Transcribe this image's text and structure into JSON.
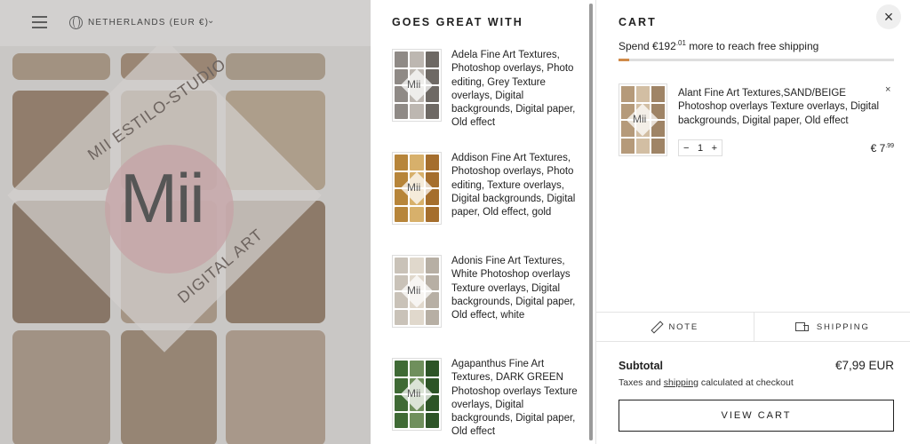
{
  "background": {
    "country_selector": "NETHERLANDS (EUR €)",
    "logo": {
      "wordmark": "Mii",
      "top_text": "MII ESTILO-STUDIO",
      "bottom_text": "DIGITAL ART"
    }
  },
  "upsell": {
    "title": "GOES GREAT WITH",
    "items": [
      {
        "title": "Adela Fine Art Textures, Photoshop overlays, Photo editing, Grey Texture overlays, Digital backgrounds, Digital paper, Old effect",
        "palette": [
          "#8f8a86",
          "#bdb7b1",
          "#6e6964",
          "#a7a19b"
        ]
      },
      {
        "title": "Addison Fine Art Textures, Photoshop overlays, Photo editing, Texture overlays, Digital backgrounds, Digital paper, Old effect, gold",
        "palette": [
          "#b7853a",
          "#d7b06b",
          "#a56e2d",
          "#e4c58a"
        ]
      },
      {
        "title": "Adonis Fine Art Textures, White Photoshop overlays Texture overlays, Digital backgrounds, Digital paper, Old effect, white",
        "palette": [
          "#c9c2b8",
          "#e0d8cc",
          "#b7afa4",
          "#ece6dc"
        ]
      },
      {
        "title": "Agapanthus Fine Art Textures, DARK GREEN Photoshop overlays Texture overlays, Digital backgrounds, Digital paper, Old effect",
        "palette": [
          "#3f6a35",
          "#6f8f5c",
          "#2d5427",
          "#8ba877"
        ]
      }
    ]
  },
  "cart": {
    "title": "CART",
    "shipping_message": {
      "prefix": "Spend",
      "currency": "€",
      "amount_main": "192",
      "amount_cents": ".01",
      "suffix": "more to reach free shipping"
    },
    "shipping_progress": 0.04,
    "line_item": {
      "title": "Alant Fine Art Textures,SAND/BEIGE Photoshop overlays Texture overlays, Digital backgrounds, Digital paper, Old effect",
      "quantity": "1",
      "price_main": "€ 7",
      "price_cents": ".99",
      "remove_icon": "×",
      "palette": [
        "#b59a7a",
        "#d2bea3",
        "#9f8466",
        "#c8b395"
      ]
    },
    "tools": {
      "note": "NOTE",
      "shipping": "SHIPPING"
    },
    "subtotal_label": "Subtotal",
    "subtotal_value": "€7,99 EUR",
    "tax_note_prefix": "Taxes and",
    "tax_note_link": "shipping",
    "tax_note_suffix": "calculated at checkout",
    "view_cart_label": "VIEW CART",
    "close_icon": "×"
  },
  "colors": {
    "accent": "#d08b4a",
    "overlay": "#787878"
  }
}
